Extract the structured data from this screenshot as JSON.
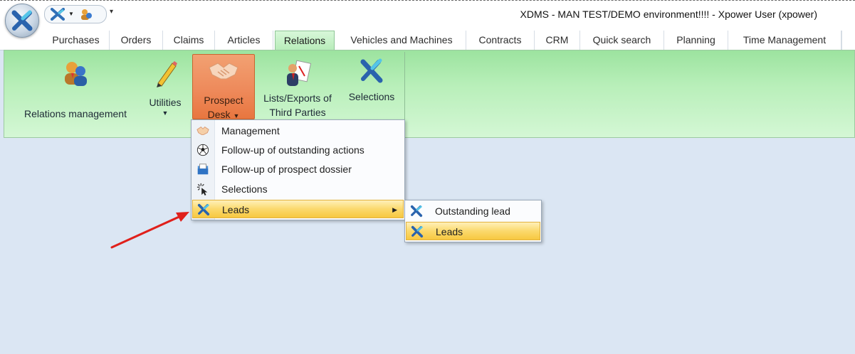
{
  "window": {
    "title": "XDMS - MAN TEST/DEMO environment!!!! - Xpower User (xpower)",
    "qat_dropdown": "▾"
  },
  "tabs": [
    {
      "label": "Purchases",
      "active": false
    },
    {
      "label": "Orders",
      "active": false
    },
    {
      "label": "Claims",
      "active": false
    },
    {
      "label": "Articles",
      "active": false
    },
    {
      "label": "Relations",
      "active": true
    },
    {
      "label": "Vehicles and Machines",
      "active": false
    },
    {
      "label": "Contracts",
      "active": false
    },
    {
      "label": "CRM",
      "active": false
    },
    {
      "label": "Quick search",
      "active": false
    },
    {
      "label": "Planning",
      "active": false
    },
    {
      "label": "Time Management",
      "active": false
    }
  ],
  "ribbon": {
    "buttons": {
      "relations_management": {
        "label": "Relations management",
        "icon": "people-icon"
      },
      "utilities": {
        "label": "Utilities",
        "icon": "pencil-icon"
      },
      "prospect_desk": {
        "line1": "Prospect",
        "line2": "Desk",
        "icon": "handshake-icon",
        "active": true
      },
      "lists_exports": {
        "line1": "Lists/Exports of",
        "line2": "Third Parties",
        "icon": "report-icon"
      },
      "selections": {
        "label": "Selections",
        "icon": "xdms-icon"
      }
    }
  },
  "dropdown_menu": {
    "items": [
      {
        "label": "Management",
        "icon": "handshake-icon"
      },
      {
        "label": "Follow-up of outstanding actions",
        "icon": "soccer-ball-icon"
      },
      {
        "label": "Follow-up of prospect dossier",
        "icon": "folder-icon"
      },
      {
        "label": "Selections",
        "icon": "cursor-click-icon"
      },
      {
        "label": "Leads",
        "icon": "xdms-icon",
        "highlighted": true,
        "has_submenu": true
      }
    ]
  },
  "submenu": {
    "items": [
      {
        "label": "Outstanding lead",
        "icon": "xdms-icon"
      },
      {
        "label": "Leads",
        "icon": "xdms-icon",
        "highlighted": true
      }
    ]
  },
  "colors": {
    "ribbon_green": "#b8efb9",
    "active_orange": "#ee8a5b",
    "highlight_yellow": "#fbd96d",
    "annotation_red": "#e0201b",
    "background": "#dbe6f3"
  }
}
